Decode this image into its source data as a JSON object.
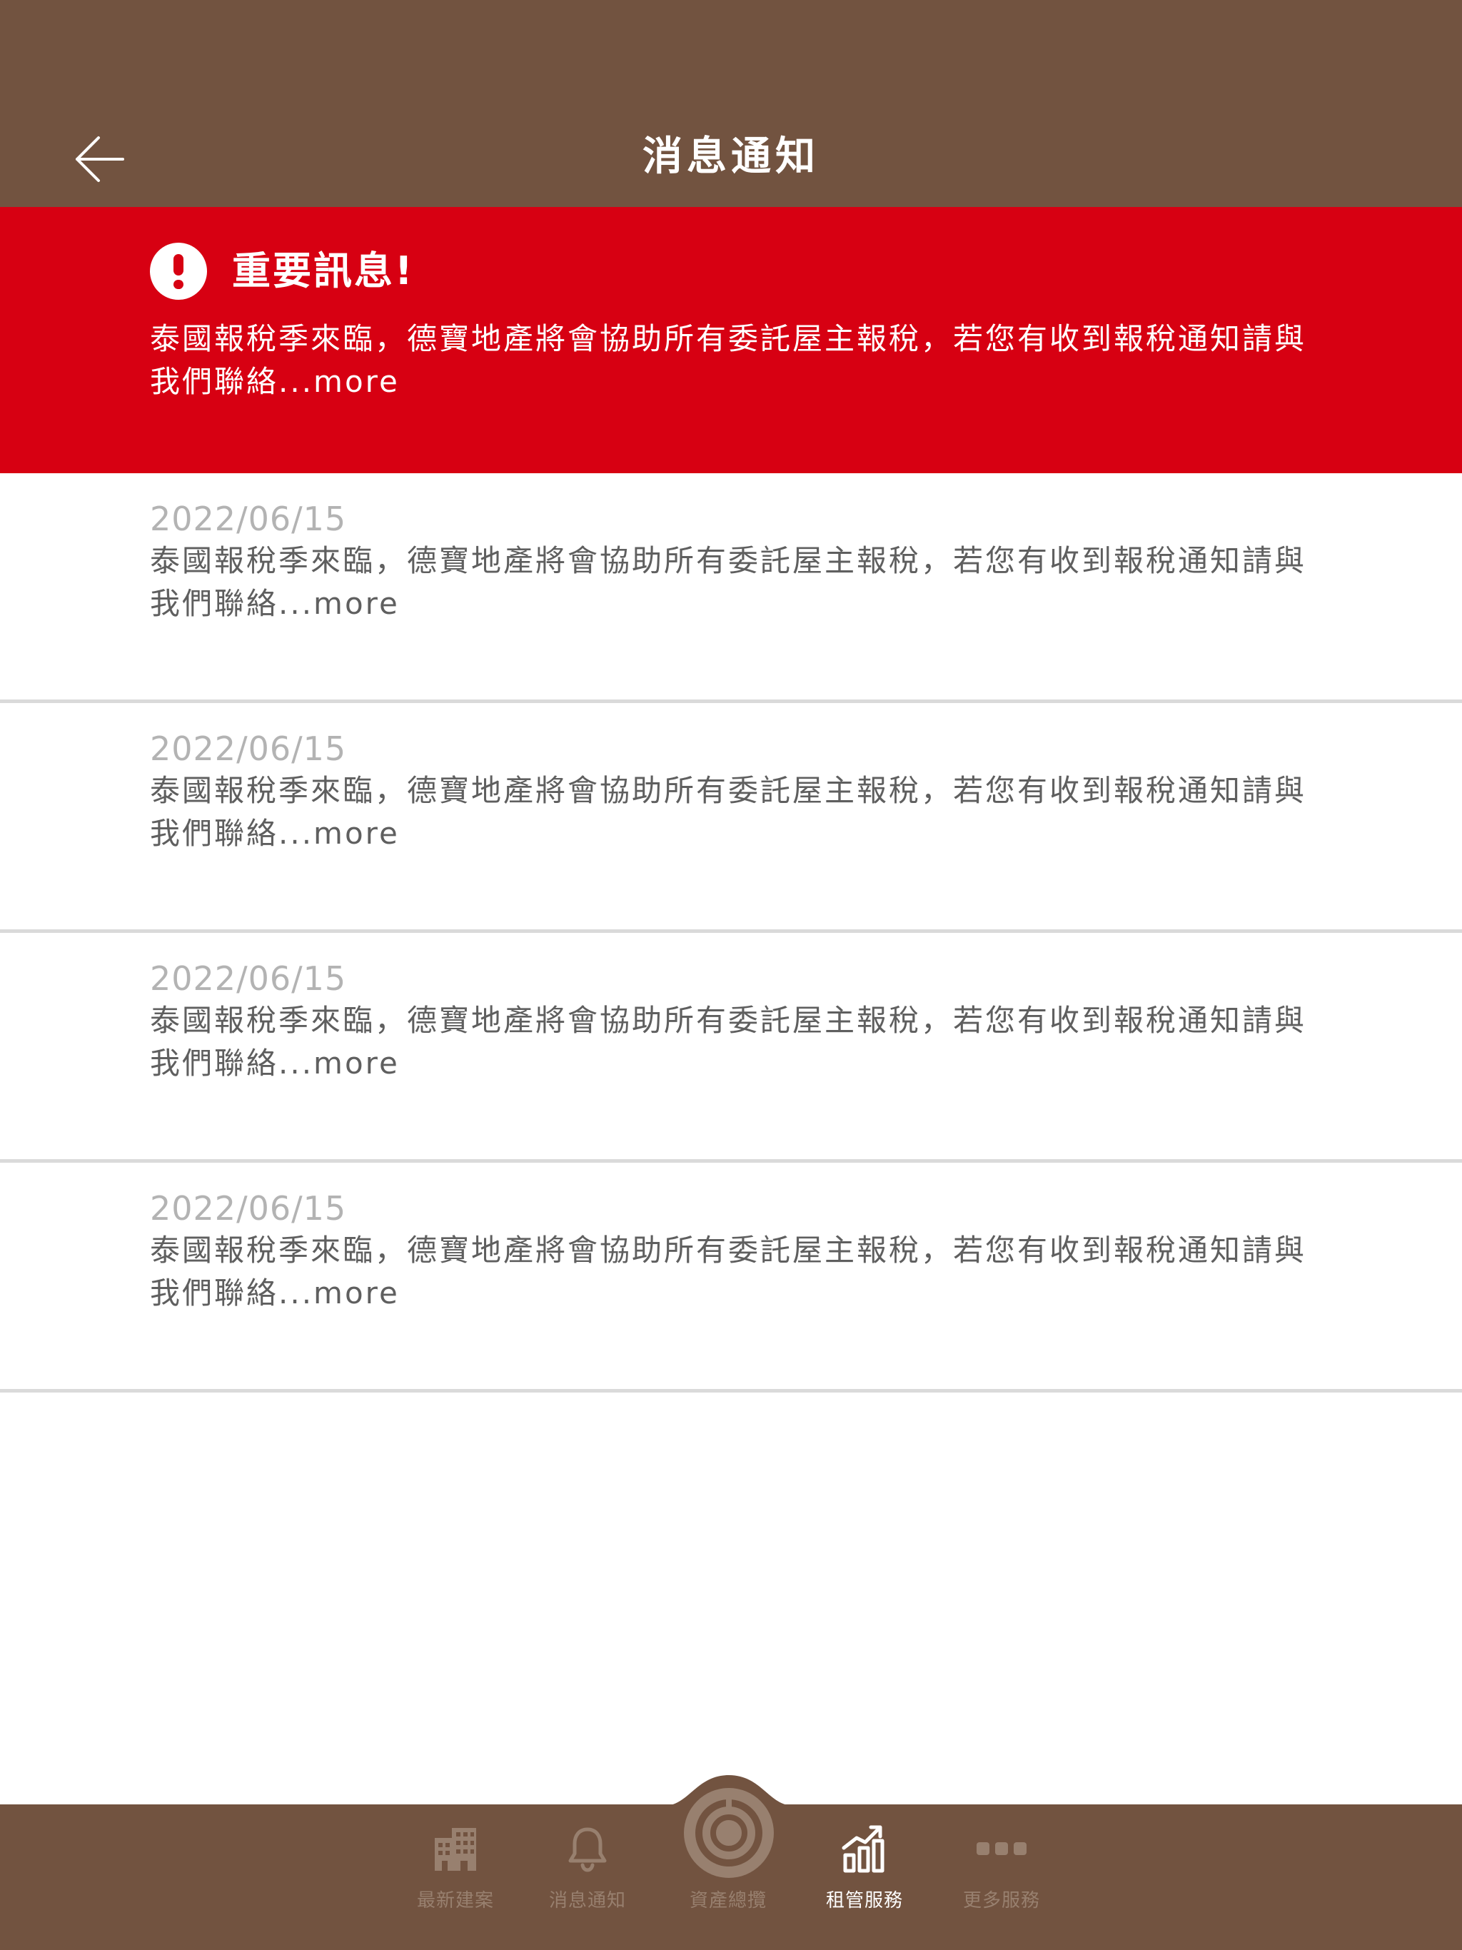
{
  "header": {
    "title": "消息通知",
    "back_icon": "arrow-left-icon"
  },
  "alert": {
    "icon": "exclamation-circle-icon",
    "title": "重要訊息!",
    "body": "泰國報稅季來臨，德寶地產將會協助所有委託屋主報稅，若您有收到報稅通知請與我們聯絡...more"
  },
  "notices": [
    {
      "date": "2022/06/15",
      "text": "泰國報稅季來臨，德寶地產將會協助所有委託屋主報稅，若您有收到報稅通知請與我們聯絡...more"
    },
    {
      "date": "2022/06/15",
      "text": "泰國報稅季來臨，德寶地產將會協助所有委託屋主報稅，若您有收到報稅通知請與我們聯絡...more"
    },
    {
      "date": "2022/06/15",
      "text": "泰國報稅季來臨，德寶地產將會協助所有委託屋主報稅，若您有收到報稅通知請與我們聯絡...more"
    },
    {
      "date": "2022/06/15",
      "text": "泰國報稅季來臨，德寶地產將會協助所有委託屋主報稅，若您有收到報稅通知請與我們聯絡...more"
    }
  ],
  "tabbar": {
    "tabs": [
      {
        "label": "最新建案",
        "icon": "building-icon",
        "active": false
      },
      {
        "label": "消息通知",
        "icon": "bell-icon",
        "active": false
      },
      {
        "label": "資產總攬",
        "icon": "asset-overview-icon",
        "active": false
      },
      {
        "label": "租管服務",
        "icon": "growth-chart-icon",
        "active": true
      },
      {
        "label": "更多服務",
        "icon": "more-dots-icon",
        "active": false
      }
    ]
  },
  "colors": {
    "brand_brown": "#725340",
    "alert_red": "#d70012",
    "inactive_tab": "#98806f",
    "active_tab": "#ffffff",
    "divider": "#dadada"
  }
}
